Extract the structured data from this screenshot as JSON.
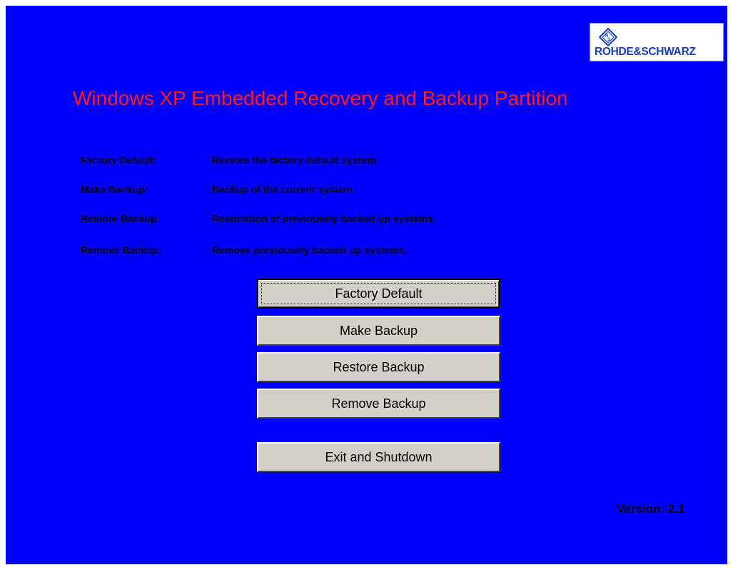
{
  "brand": {
    "name": "ROHDE&SCHWARZ",
    "icon": "rohde-schwarz-logo-icon"
  },
  "title": "Windows XP Embedded Recovery and Backup Partition",
  "descriptions": [
    {
      "label": "Factory Default:",
      "text": "Restore the factory default system."
    },
    {
      "label": "Make Backup:",
      "text": "Backup of the current system."
    },
    {
      "label": "Restore Backup:",
      "text": "Restoration of previousely backed up systems."
    },
    {
      "label": "Remove Backup:",
      "text": "Remove previousely backed up systems."
    }
  ],
  "buttons": {
    "factory_default": "Factory Default",
    "make_backup": "Make Backup",
    "restore_backup": "Restore Backup",
    "remove_backup": "Remove Backup",
    "exit_shutdown": "Exit and Shutdown"
  },
  "version": "Version: 2.1",
  "colors": {
    "background": "#0000ff",
    "title": "#ff1a1a",
    "button_face": "#d4d0c8"
  }
}
